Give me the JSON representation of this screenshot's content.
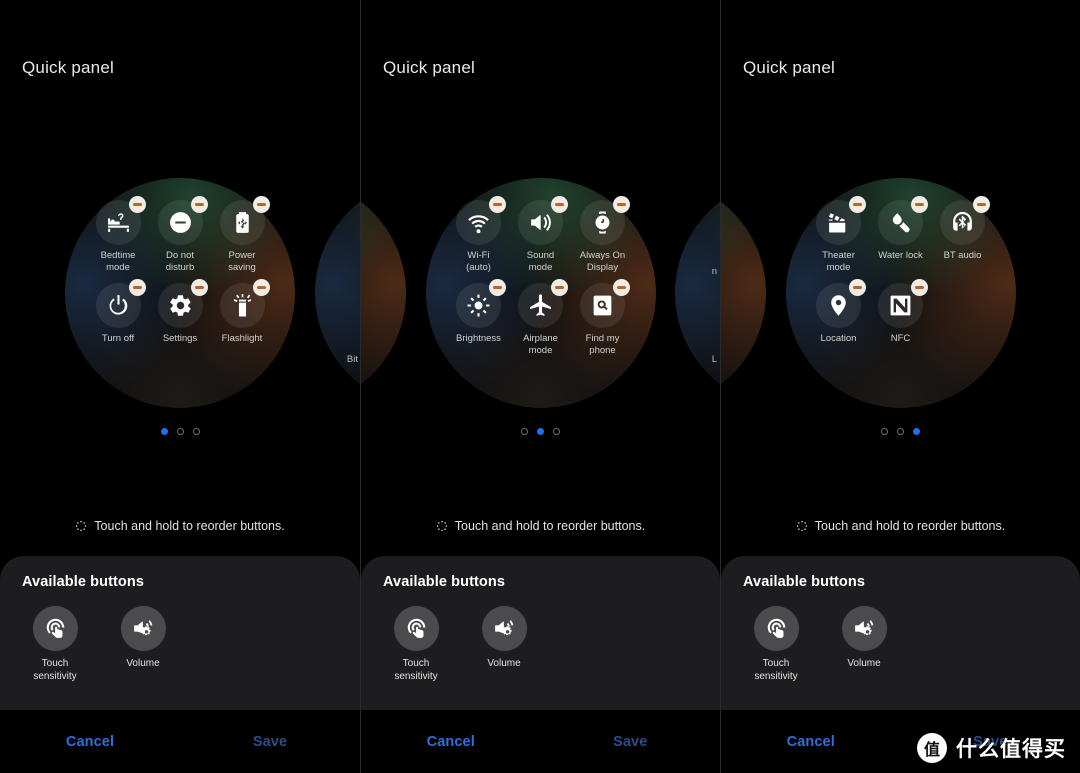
{
  "colors": {
    "background": "#000000",
    "accent_blue": "#1a73f0",
    "cancel_blue": "#2f6fdd",
    "save_blue": "#2a4e85",
    "card_bg": "#1d1d1f",
    "badge_bg": "#f3ece4",
    "badge_minus": "#c2602a"
  },
  "panels": [
    {
      "title": "Quick panel",
      "active_page": 0,
      "page_count": 3,
      "tiles": [
        {
          "label": "Bedtime\nmode",
          "icon": "bedtime-icon",
          "badge": "remove-icon"
        },
        {
          "label": "Do not\ndisturb",
          "icon": "do-not-disturb-icon",
          "badge": "remove-icon"
        },
        {
          "label": "Power\nsaving",
          "icon": "power-saving-icon",
          "badge": "remove-icon"
        },
        {
          "label": "Turn off",
          "icon": "power-off-icon",
          "badge": "remove-icon"
        },
        {
          "label": "Settings",
          "icon": "gear-icon",
          "badge": "remove-icon"
        },
        {
          "label": "Flashlight",
          "icon": "flashlight-icon",
          "badge": "remove-icon"
        }
      ],
      "hint": "Touch and hold to reorder buttons.",
      "card_title": "Available buttons",
      "available": [
        {
          "label": "Touch\nsensitivity",
          "icon": "touch-sensitivity-icon"
        },
        {
          "label": "Volume",
          "icon": "volume-gear-icon"
        }
      ],
      "cancel_label": "Cancel",
      "save_label": "Save",
      "ghost_right": "Bit"
    },
    {
      "title": "Quick panel",
      "active_page": 1,
      "page_count": 3,
      "tiles": [
        {
          "label": "Wi-Fi\n(auto)",
          "icon": "wifi-icon",
          "badge": "remove-icon"
        },
        {
          "label": "Sound\nmode",
          "icon": "sound-mode-icon",
          "badge": "remove-icon"
        },
        {
          "label": "Always On\nDisplay",
          "icon": "always-on-display-icon",
          "badge": "remove-icon"
        },
        {
          "label": "Brightness",
          "icon": "brightness-icon",
          "badge": "remove-icon"
        },
        {
          "label": "Airplane\nmode",
          "icon": "airplane-icon",
          "badge": "remove-icon"
        },
        {
          "label": "Find my\nphone",
          "icon": "find-my-phone-icon",
          "badge": "remove-icon"
        }
      ],
      "hint": "Touch and hold to reorder buttons.",
      "card_title": "Available buttons",
      "available": [
        {
          "label": "Touch\nsensitivity",
          "icon": "touch-sensitivity-icon"
        },
        {
          "label": "Volume",
          "icon": "volume-gear-icon"
        }
      ],
      "cancel_label": "Cancel",
      "save_label": "Save",
      "ghost_right_top": "n",
      "ghost_right_bottom": "L"
    },
    {
      "title": "Quick panel",
      "active_page": 2,
      "page_count": 3,
      "tiles": [
        {
          "label": "Theater\nmode",
          "icon": "theater-mode-icon",
          "badge": "remove-icon"
        },
        {
          "label": "Water lock",
          "icon": "water-lock-icon",
          "badge": "remove-icon"
        },
        {
          "label": "BT audio",
          "icon": "bt-audio-icon",
          "badge": "remove-icon"
        },
        {
          "label": "Location",
          "icon": "location-pin-icon",
          "badge": "remove-icon"
        },
        {
          "label": "NFC",
          "icon": "nfc-icon",
          "badge": "remove-icon"
        }
      ],
      "hint": "Touch and hold to reorder buttons.",
      "card_title": "Available buttons",
      "available": [
        {
          "label": "Touch\nsensitivity",
          "icon": "touch-sensitivity-icon"
        },
        {
          "label": "Volume",
          "icon": "volume-gear-icon"
        }
      ],
      "cancel_label": "Cancel",
      "save_label": "Save"
    }
  ],
  "watermark": {
    "badge_char": "值",
    "text": "什么值得买"
  }
}
